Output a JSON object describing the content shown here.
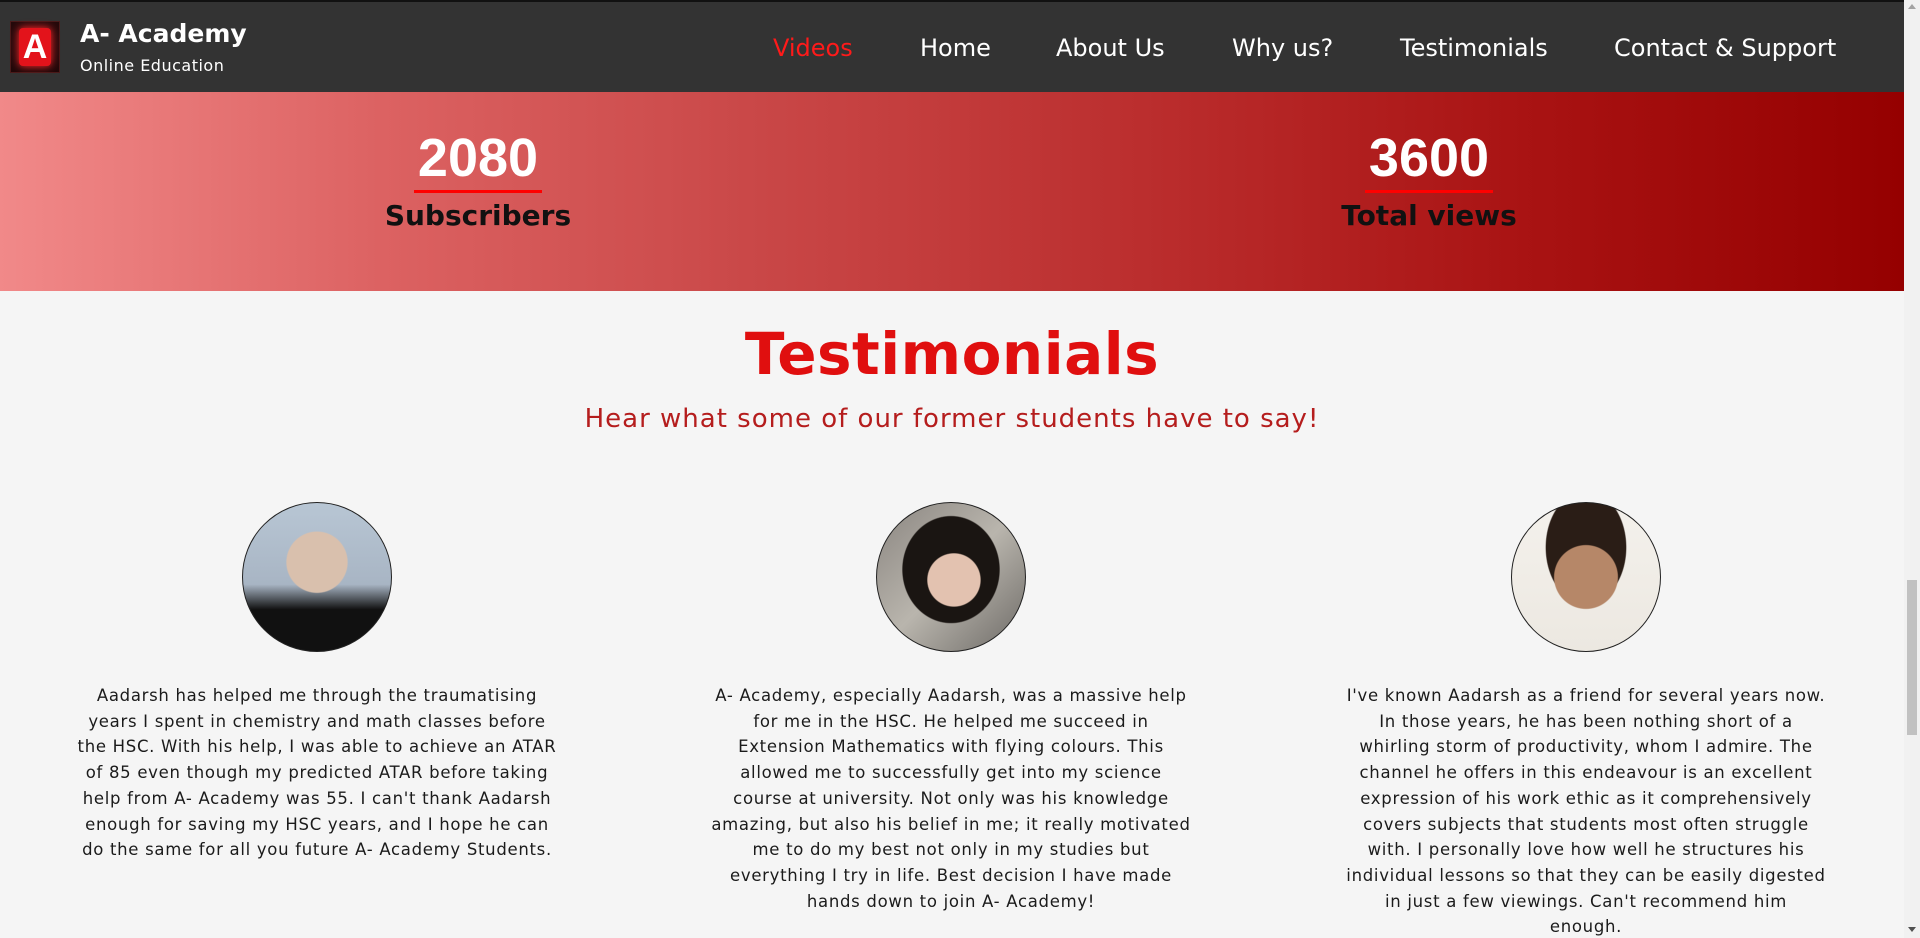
{
  "brand": {
    "logo_letter": "A",
    "title": "A- Academy",
    "subtitle": "Online Education"
  },
  "nav": {
    "items": [
      {
        "label": "Videos",
        "active": true
      },
      {
        "label": "Home",
        "active": false
      },
      {
        "label": "About Us",
        "active": false
      },
      {
        "label": "Why us?",
        "active": false
      },
      {
        "label": "Testimonials",
        "active": false
      },
      {
        "label": "Contact & Support",
        "active": false
      }
    ]
  },
  "stats": [
    {
      "value": "2080",
      "label": "Subscribers"
    },
    {
      "value": "3600",
      "label": "Total views"
    }
  ],
  "testimonials": {
    "title": "Testimonials",
    "subtitle": "Hear what some of our former students have to say!",
    "items": [
      {
        "quote": "Aadarsh has helped me through the traumatising years I spent in chemistry and math classes before the HSC. With his help, I was able to achieve an ATAR of 85 even though my predicted ATAR before taking help from A- Academy was 55. I can't thank Aadarsh enough for saving my HSC years, and I hope he can do the same for all you future A- Academy Students."
      },
      {
        "quote": "A- Academy, especially Aadarsh, was a massive help for me in the HSC. He helped me succeed in Extension Mathematics with flying colours. This allowed me to successfully get into my science course at university. Not only was his knowledge amazing, but also his belief in me; it really motivated me to do my best not only in my studies but everything I try in life. Best decision I have made hands down to join A- Academy!"
      },
      {
        "quote": "I've known Aadarsh as a friend for several years now. In those years, he has been nothing short of a whirling storm of productivity, whom I admire. The channel he offers in this endeavour is an excellent expression of his work ethic as it comprehensively covers subjects that students most often struggle with. I personally love how well he structures his individual lessons so that they can be easily digested in just a few viewings. Can't recommend him enough."
      }
    ]
  },
  "colors": {
    "nav_bg": "#333333",
    "accent": "#e00f0f",
    "active_nav": "#ff1a1a",
    "stats_gradient_start": "#f18989",
    "stats_gradient_end": "#950000"
  }
}
